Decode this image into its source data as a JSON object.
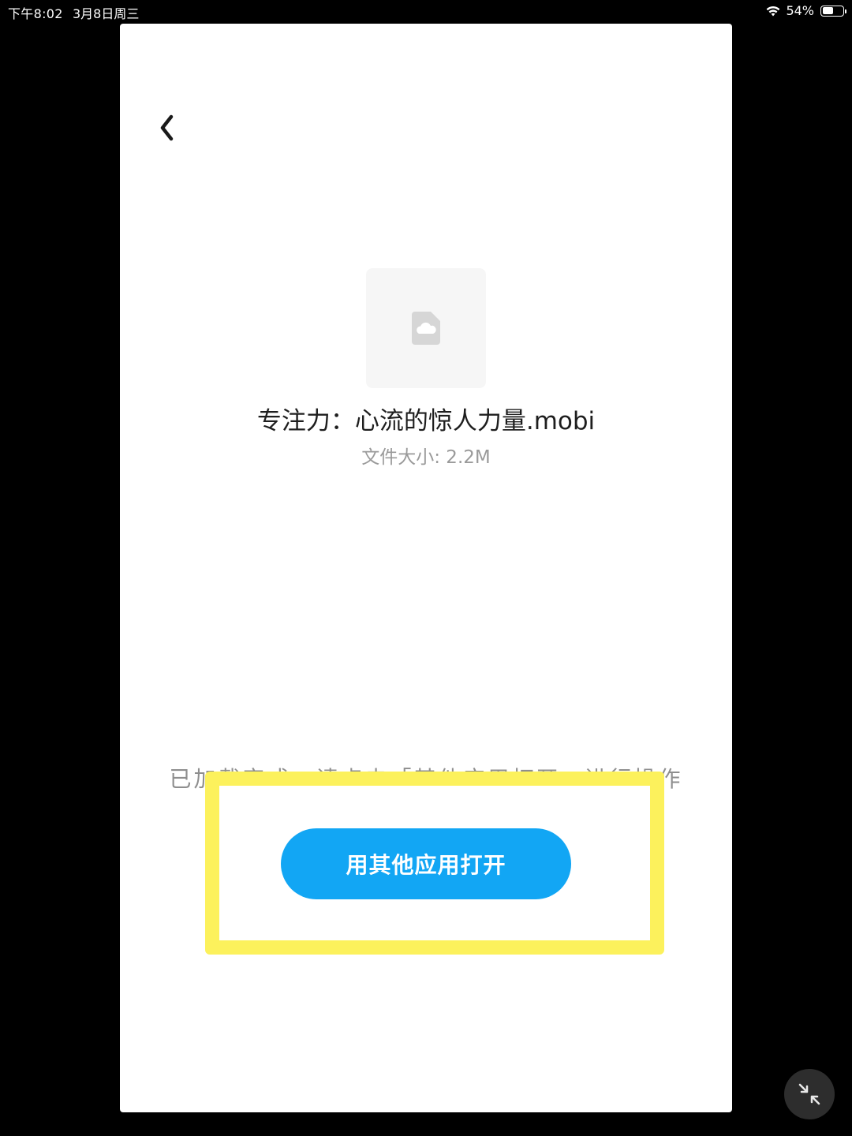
{
  "status_bar": {
    "time": "下午8:02",
    "date": "3月8日周三",
    "battery_percent": "54%",
    "battery_level": 0.54,
    "wifi_icon": "wifi-icon",
    "battery_icon": "battery-icon"
  },
  "nav": {
    "back_icon": "chevron-left-icon"
  },
  "file": {
    "icon": "cloud-file-icon",
    "name": "专注力：心流的惊人力量.mobi",
    "size_text": "文件大小: 2.2M"
  },
  "hint": "已加载完成，请点击「其他应用打开」进行操作",
  "actions": {
    "open_with_other_app": "用其他应用打开"
  },
  "overlay": {
    "minimize_icon": "minimize-arrows-icon"
  },
  "colors": {
    "primary_button": "#12a6f4",
    "highlight": "#fcf15c",
    "panel_bg": "#ffffff",
    "screen_bg": "#000000"
  }
}
